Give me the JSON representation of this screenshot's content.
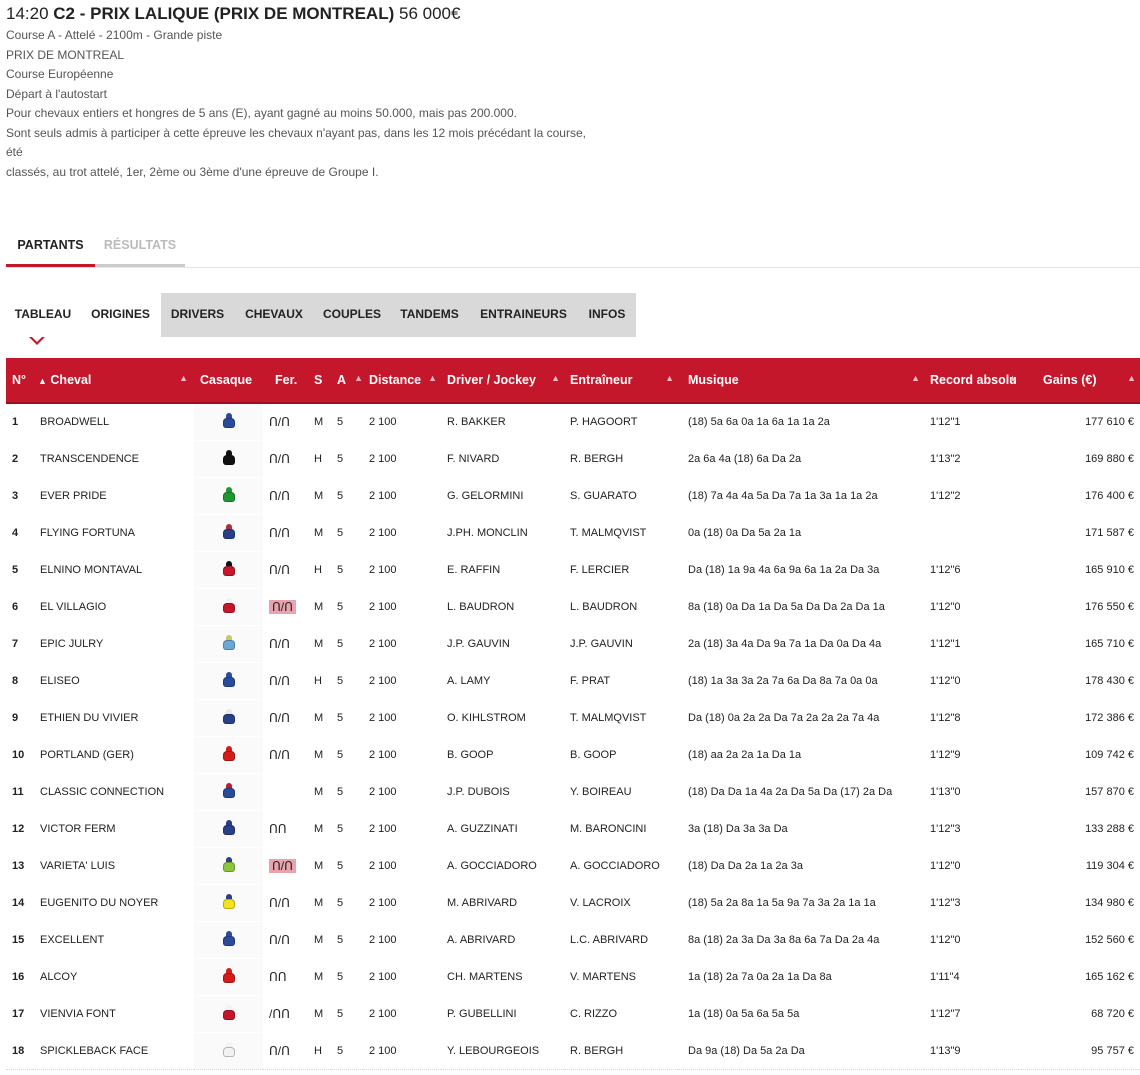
{
  "race": {
    "time": "14:20",
    "code": "C2",
    "name": "- PRIX LALIQUE (PRIX DE MONTREAL)",
    "prize": "56 000€",
    "lines": [
      "Course A - Attelé - 2100m - Grande piste",
      "PRIX DE MONTREAL",
      "Course Européenne",
      "Départ à l'autostart",
      "Pour chevaux entiers et hongres de 5 ans (E), ayant gagné au moins 50.000, mais pas 200.000.",
      "Sont seuls admis à participer à cette épreuve les chevaux n'ayant pas, dans les 12 mois précédant la course,",
      "été",
      "classés, au trot attelé, 1er, 2ème ou 3ème d'une épreuve de Groupe I."
    ]
  },
  "main_tabs": [
    "PARTANTS",
    "RÉSULTATS"
  ],
  "sub_tabs": [
    "TABLEAU",
    "ORIGINES",
    "DRIVERS",
    "CHEVAUX",
    "COUPLES",
    "TANDEMS",
    "ENTRAINEURS",
    "INFOS"
  ],
  "columns": [
    "N°",
    "Cheval",
    "Casaque",
    "Fer.",
    "S",
    "A",
    "Distance",
    "Driver / Jockey",
    "Entraîneur",
    "Musique",
    "Record absolu",
    "Gains (€)"
  ],
  "colors": {
    "accent": "#c4172c",
    "tab_gray": "#d9d9d9"
  },
  "runners": [
    {
      "n": "1",
      "horse": "BROADWELL",
      "silk": [
        "#2a4a9a",
        "#2a4a9a"
      ],
      "fer": "ᑎ/ᑎ",
      "ferRed": false,
      "s": "M",
      "a": "5",
      "dist": "2 100",
      "jockey": "R. BAKKER",
      "trainer": "P. HAGOORT",
      "musique": "(18) 5a 6a 0a 1a 6a 1a 1a 2a",
      "record": "1'12\"1",
      "gains": "177 610 €"
    },
    {
      "n": "2",
      "horse": "TRANSCENDENCE",
      "silk": [
        "#111",
        "#111"
      ],
      "fer": "ᑎ/ᑎ",
      "ferRed": false,
      "s": "H",
      "a": "5",
      "dist": "2 100",
      "jockey": "F. NIVARD",
      "trainer": "R. BERGH",
      "musique": "2a 6a 4a (18) 6a Da 2a",
      "record": "1'13\"2",
      "gains": "169 880 €"
    },
    {
      "n": "3",
      "horse": "EVER PRIDE",
      "silk": [
        "#1d9a2f",
        "#1d9a2f"
      ],
      "fer": "ᑎ/ᑎ",
      "ferRed": false,
      "s": "M",
      "a": "5",
      "dist": "2 100",
      "jockey": "G. GELORMINI",
      "trainer": "S. GUARATO",
      "musique": "(18) 7a 4a 4a 5a Da 7a 1a 3a 1a 1a 2a",
      "record": "1'12\"2",
      "gains": "176 400 €"
    },
    {
      "n": "4",
      "horse": "FLYING FORTUNA",
      "silk": [
        "#2a3f8a",
        "#b0303a"
      ],
      "fer": "ᑎ/ᑎ",
      "ferRed": false,
      "s": "M",
      "a": "5",
      "dist": "2 100",
      "jockey": "J.PH. MONCLIN",
      "trainer": "T. MALMQVIST",
      "musique": "0a (18) 0a Da 5a 2a 1a",
      "record": "",
      "gains": "171 587 €"
    },
    {
      "n": "5",
      "horse": "ELNINO MONTAVAL",
      "silk": [
        "#c4172c",
        "#111"
      ],
      "fer": "ᑎ/ᑎ",
      "ferRed": false,
      "s": "H",
      "a": "5",
      "dist": "2 100",
      "jockey": "E. RAFFIN",
      "trainer": "F. LERCIER",
      "musique": "Da (18) 1a 9a 4a 6a 9a 6a 1a 2a Da 3a",
      "record": "1'12\"6",
      "gains": "165 910 €"
    },
    {
      "n": "6",
      "horse": "EL VILLAGIO",
      "silk": [
        "#c4172c",
        "#f2f2f2"
      ],
      "fer": "ᑎ/ᑎ",
      "ferRed": true,
      "s": "M",
      "a": "5",
      "dist": "2 100",
      "jockey": "L. BAUDRON",
      "trainer": "L. BAUDRON",
      "musique": "8a (18) 0a Da 1a Da 5a Da Da 2a Da 1a",
      "record": "1'12\"0",
      "gains": "176 550 €"
    },
    {
      "n": "7",
      "horse": "EPIC JULRY",
      "silk": [
        "#6aa7d6",
        "#c9c96a"
      ],
      "fer": "ᑎ/ᑎ",
      "ferRed": false,
      "s": "M",
      "a": "5",
      "dist": "2 100",
      "jockey": "J.P. GAUVIN",
      "trainer": "J.P. GAUVIN",
      "musique": "2a (18) 3a 4a Da 9a 7a 1a Da 0a Da 4a",
      "record": "1'12\"1",
      "gains": "165 710 €"
    },
    {
      "n": "8",
      "horse": "ELISEO",
      "silk": [
        "#2a4a9a",
        "#2a4a9a"
      ],
      "fer": "ᑎ/ᑎ",
      "ferRed": false,
      "s": "H",
      "a": "5",
      "dist": "2 100",
      "jockey": "A. LAMY",
      "trainer": "F. PRAT",
      "musique": "(18) 1a 3a 3a 2a 7a 6a Da 8a 7a 0a 0a",
      "record": "1'12\"0",
      "gains": "178 430 €"
    },
    {
      "n": "9",
      "horse": "ETHIEN DU VIVIER",
      "silk": [
        "#2a3f8a",
        "#e8e8e8"
      ],
      "fer": "ᑎ/ᑎ",
      "ferRed": false,
      "s": "M",
      "a": "5",
      "dist": "2 100",
      "jockey": "O. KIHLSTROM",
      "trainer": "T. MALMQVIST",
      "musique": "Da (18) 0a 2a 2a Da 7a 2a 2a 2a 7a 4a",
      "record": "1'12\"8",
      "gains": "172 386 €"
    },
    {
      "n": "10",
      "horse": "PORTLAND (GER)",
      "silk": [
        "#d41c1c",
        "#d41c1c"
      ],
      "fer": "ᑎ/ᑎ",
      "ferRed": false,
      "s": "M",
      "a": "5",
      "dist": "2 100",
      "jockey": "B. GOOP",
      "trainer": "B. GOOP",
      "musique": "(18) aa 2a 2a 1a Da 1a",
      "record": "1'12\"9",
      "gains": "109 742 €"
    },
    {
      "n": "11",
      "horse": "CLASSIC CONNECTION",
      "silk": [
        "#2a4a9a",
        "#c4172c"
      ],
      "fer": "",
      "ferRed": false,
      "s": "M",
      "a": "5",
      "dist": "2 100",
      "jockey": "J.P. DUBOIS",
      "trainer": "Y. BOIREAU",
      "musique": "(18) Da Da 1a 4a 2a Da 5a Da (17) 2a Da",
      "record": "1'13\"0",
      "gains": "157 870 €"
    },
    {
      "n": "12",
      "horse": "VICTOR FERM",
      "silk": [
        "#2a3f8a",
        "#2a3f8a"
      ],
      "fer": "ᑎᑎ",
      "ferRed": false,
      "s": "M",
      "a": "5",
      "dist": "2 100",
      "jockey": "A. GUZZINATI",
      "trainer": "M. BARONCINI",
      "musique": "3a (18) Da 3a 3a Da",
      "record": "1'12\"3",
      "gains": "133 288 €"
    },
    {
      "n": "13",
      "horse": "VARIETA' LUIS",
      "silk": [
        "#8cc63f",
        "#2a3f8a"
      ],
      "fer": "ᑎ/ᑎ",
      "ferRed": true,
      "s": "M",
      "a": "5",
      "dist": "2 100",
      "jockey": "A. GOCCIADORO",
      "trainer": "A. GOCCIADORO",
      "musique": "(18) Da Da 2a 1a 2a 3a",
      "record": "1'12\"0",
      "gains": "119 304 €"
    },
    {
      "n": "14",
      "horse": "EUGENITO DU NOYER",
      "silk": [
        "#f2e31a",
        "#2a3f8a"
      ],
      "fer": "ᑎ/ᑎ",
      "ferRed": false,
      "s": "M",
      "a": "5",
      "dist": "2 100",
      "jockey": "M. ABRIVARD",
      "trainer": "V. LACROIX",
      "musique": "(18) 5a 2a 8a 1a 5a 9a 7a 3a 2a 1a 1a",
      "record": "1'12\"3",
      "gains": "134 980 €"
    },
    {
      "n": "15",
      "horse": "EXCELLENT",
      "silk": [
        "#2a4a9a",
        "#2a4a9a"
      ],
      "fer": "ᑎ/ᑎ",
      "ferRed": false,
      "s": "M",
      "a": "5",
      "dist": "2 100",
      "jockey": "A. ABRIVARD",
      "trainer": "L.C. ABRIVARD",
      "musique": "8a (18) 2a 3a Da 3a 8a 6a 7a Da 2a 4a",
      "record": "1'12\"0",
      "gains": "152 560 €"
    },
    {
      "n": "16",
      "horse": "ALCOY",
      "silk": [
        "#d41c1c",
        "#d41c1c"
      ],
      "fer": "ᑎᑎ",
      "ferRed": false,
      "s": "M",
      "a": "5",
      "dist": "2 100",
      "jockey": "CH. MARTENS",
      "trainer": "V. MARTENS",
      "musique": "1a (18) 2a 7a 0a 2a 1a Da 8a",
      "record": "1'11\"4",
      "gains": "165 162 €"
    },
    {
      "n": "17",
      "horse": "VIENVIA FONT",
      "silk": [
        "#c4172c",
        "#f2f2f2"
      ],
      "fer": "/ᑎᑎ",
      "ferRed": false,
      "s": "M",
      "a": "5",
      "dist": "2 100",
      "jockey": "P. GUBELLINI",
      "trainer": "C. RIZZO",
      "musique": "1a (18) 0a 5a 6a 5a 5a",
      "record": "1'12\"7",
      "gains": "68 720 €"
    },
    {
      "n": "18",
      "horse": "SPICKLEBACK FACE",
      "silk": [
        "#f2f2f2",
        "#f2f2f2"
      ],
      "fer": "ᑎ/ᑎ",
      "ferRed": false,
      "s": "H",
      "a": "5",
      "dist": "2 100",
      "jockey": "Y. LEBOURGEOIS",
      "trainer": "R. BERGH",
      "musique": "Da 9a (18) Da 5a 2a Da",
      "record": "1'13\"9",
      "gains": "95 757 €"
    }
  ]
}
